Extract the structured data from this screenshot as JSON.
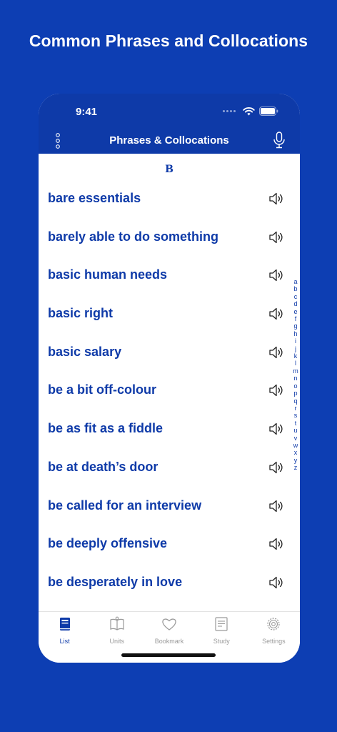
{
  "promo": {
    "title": "Common Phrases and Collocations"
  },
  "status_bar": {
    "time": "9:41"
  },
  "nav": {
    "title": "Phrases & Collocations"
  },
  "list": {
    "section_letter": "B",
    "items": [
      {
        "label": "bare essentials"
      },
      {
        "label": "barely able to do something"
      },
      {
        "label": "basic human needs"
      },
      {
        "label": "basic right"
      },
      {
        "label": "basic salary"
      },
      {
        "label": "be a bit off-colour"
      },
      {
        "label": "be as fit as a fiddle"
      },
      {
        "label": "be at death’s door"
      },
      {
        "label": "be called for an interview"
      },
      {
        "label": "be deeply offensive"
      },
      {
        "label": "be desperately in love"
      }
    ]
  },
  "alpha_index": [
    "a",
    "b",
    "c",
    "d",
    "e",
    "f",
    "g",
    "h",
    "i",
    "j",
    "k",
    "l",
    "m",
    "n",
    "o",
    "p",
    "q",
    "r",
    "s",
    "t",
    "u",
    "v",
    "w",
    "x",
    "y",
    "z"
  ],
  "tabs": [
    {
      "label": "List",
      "icon": "book-icon",
      "active": true
    },
    {
      "label": "Units",
      "icon": "open-book-icon",
      "active": false
    },
    {
      "label": "Bookmark",
      "icon": "heart-icon",
      "active": false
    },
    {
      "label": "Study",
      "icon": "document-icon",
      "active": false
    },
    {
      "label": "Settings",
      "icon": "gear-icon",
      "active": false
    }
  ],
  "colors": {
    "background": "#0d3eb3",
    "accent": "#0e3aa8",
    "inactive_tab": "#9a9a9a"
  }
}
